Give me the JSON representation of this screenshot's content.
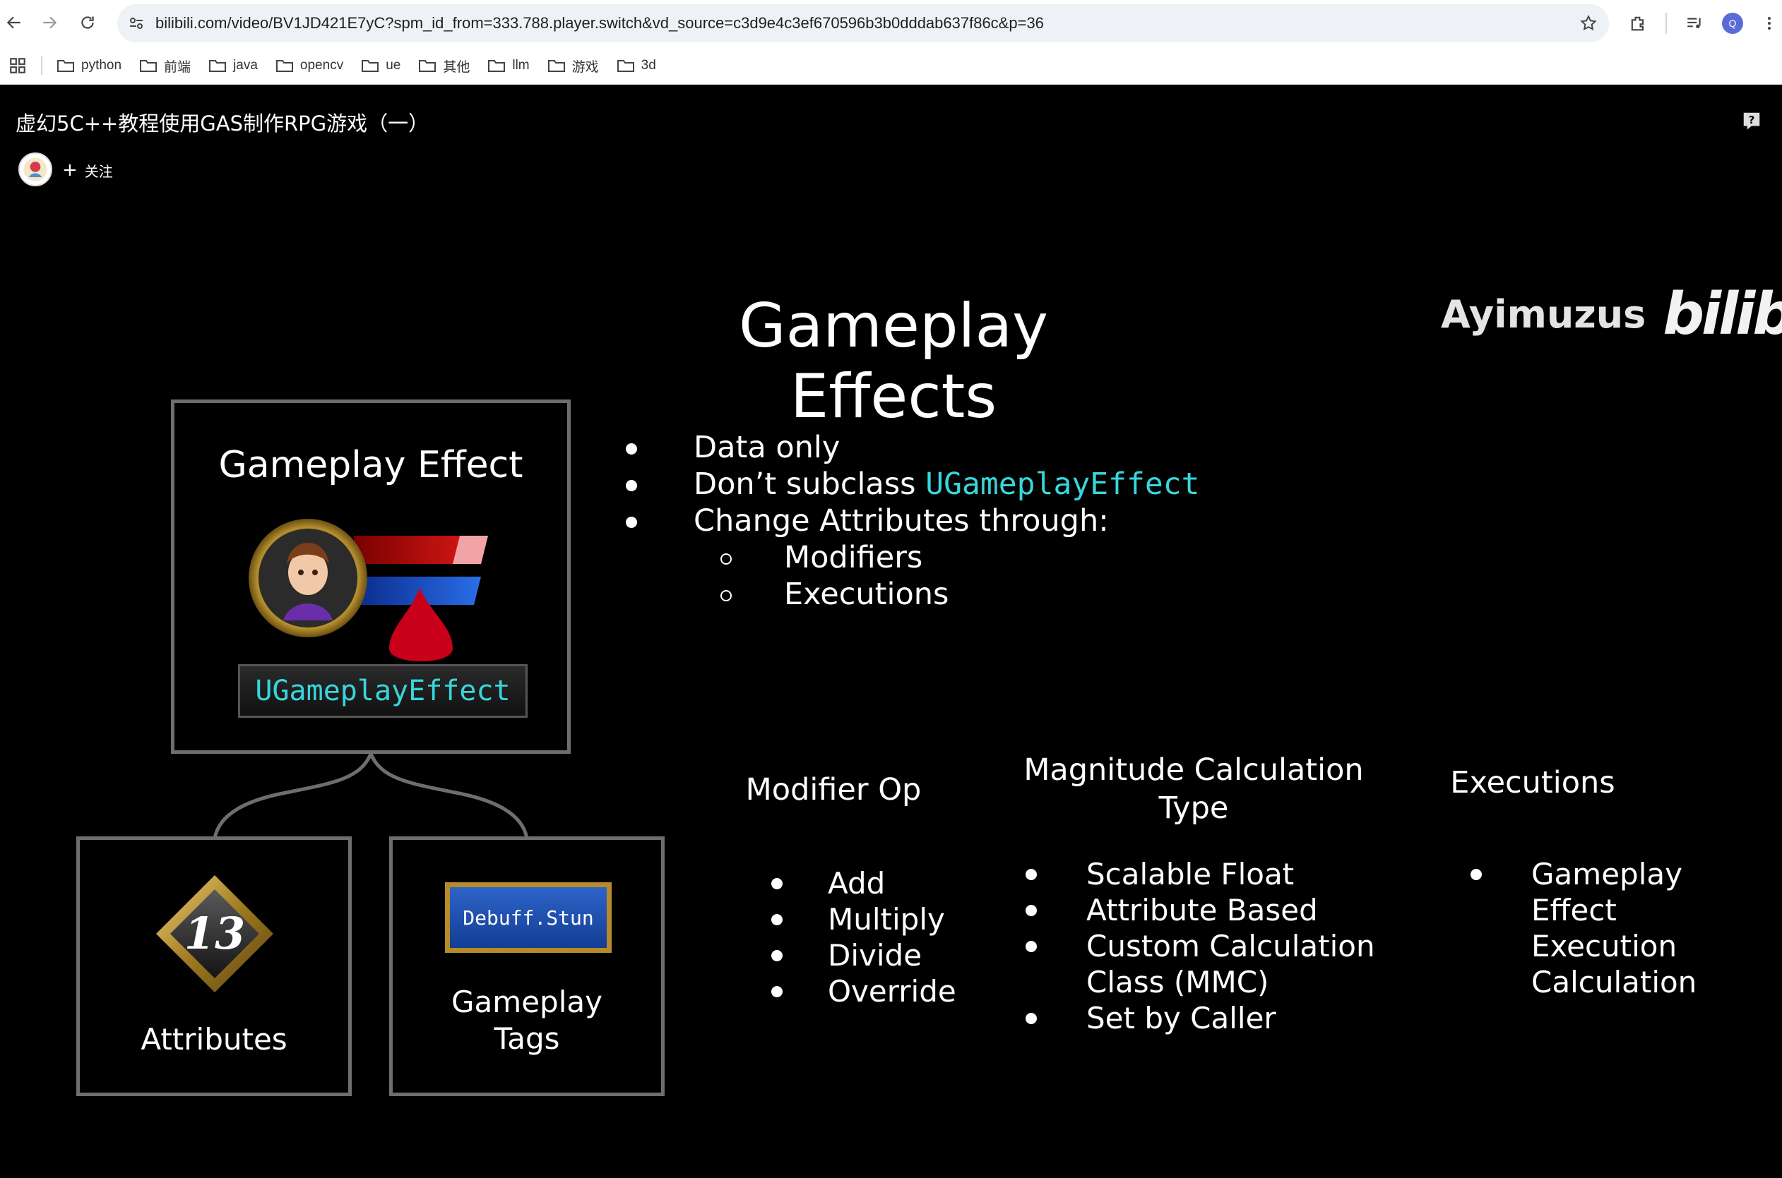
{
  "browser": {
    "url": "bilibili.com/video/BV1JD421E7yC?spm_id_from=333.788.player.switch&vd_source=c3d9e4c3ef670596b3b0dddab637f86c&p=36",
    "profile_initial": "Q",
    "bookmarks": [
      "python",
      "前端",
      "java",
      "opencv",
      "ue",
      "其他",
      "llm",
      "游戏",
      "3d"
    ]
  },
  "video": {
    "title": "虚幻5C++教程使用GAS制作RPG游戏（一）",
    "follow_label": "关注"
  },
  "slide": {
    "title": "Gameplay Effects",
    "brand_name": "Ayimuzus",
    "brand_logo": "bilibili",
    "effect_box": {
      "title": "Gameplay Effect",
      "class_label": "UGameplayEffect"
    },
    "attributes_box": {
      "number": "13",
      "label": "Attributes"
    },
    "tags_box": {
      "tag": "Debuff.Stun",
      "label_line1": "Gameplay",
      "label_line2": "Tags"
    },
    "bullets": {
      "item1": "Data only",
      "item2_prefix": "Don’t subclass ",
      "item2_code": "UGameplayEffect",
      "item3": "Change Attributes through:",
      "sub1": "Modifiers",
      "sub2": "Executions"
    },
    "modifier_op": {
      "heading": "Modifier Op",
      "items": [
        "Add",
        "Multiply",
        "Divide",
        "Override"
      ]
    },
    "magnitude": {
      "heading_line1": "Magnitude Calculation",
      "heading_line2": "Type",
      "items": [
        "Scalable Float",
        "Attribute Based",
        "Custom Calculation",
        "Class (MMC)",
        "Set by Caller"
      ]
    },
    "executions": {
      "heading": "Executions",
      "items": [
        "Gameplay",
        "Effect",
        "Execution",
        "Calculation"
      ]
    }
  },
  "colors": {
    "code_cyan": "#37d6dc",
    "box_border": "#6e6e6e",
    "tag_blue": "#2d63c9",
    "tag_gold": "#b78a2a"
  }
}
